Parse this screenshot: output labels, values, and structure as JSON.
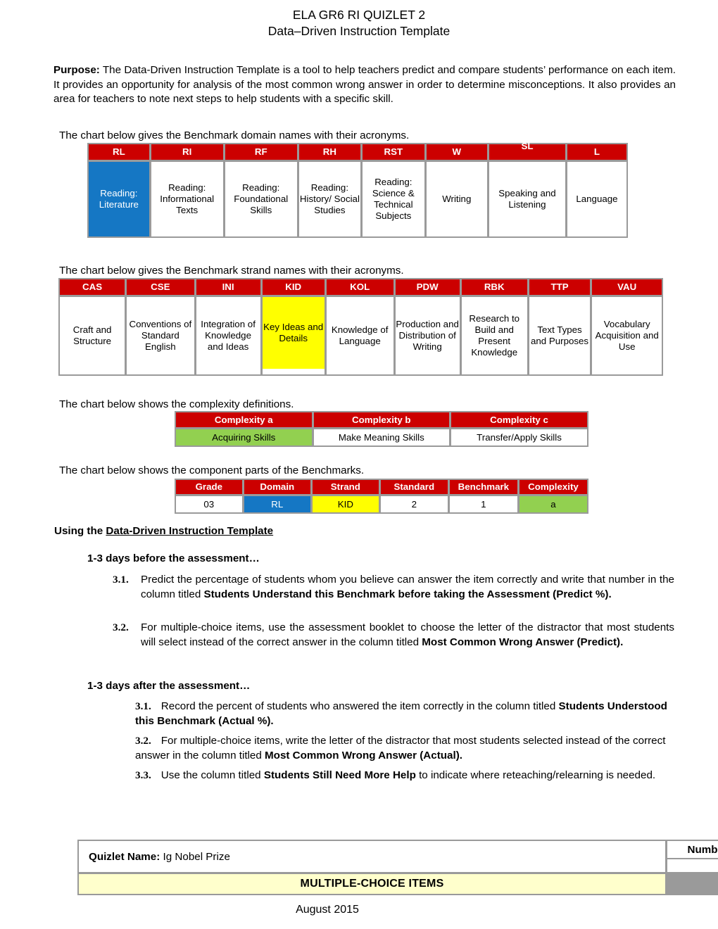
{
  "header": {
    "line1": "ELA GR6 RI QUIZLET 2",
    "line2": "Data–Driven Instruction Template"
  },
  "purpose": {
    "label": "Purpose:",
    "text": " The Data-Driven Instruction Template is a tool to help teachers predict and compare students’ performance on each item.  It provides an opportunity for analysis of the most  common wrong answer in order to determine misconceptions. It also provides an area for teachers to note next steps to help students with a specific skill."
  },
  "captions": {
    "domain": "The chart below gives the Benchmark domain names with their acronyms.",
    "strand": "The chart below gives the Benchmark strand names with their acronyms.",
    "complexity": "The chart below shows the complexity definitions.",
    "parts": "The chart below shows the component parts of the Benchmarks."
  },
  "domain_table": {
    "headers": [
      "RL",
      "RI",
      "RF",
      "RH",
      "RST",
      "W",
      "SL",
      "L"
    ],
    "values": [
      "Reading: Literature",
      "Reading: Informational Texts",
      "Reading: Foundational Skills",
      "Reading: History/ Social Studies",
      "Reading: Science & Technical Subjects",
      "Writing",
      "Speaking and Listening",
      "Language"
    ],
    "highlight_index": 0,
    "highlight_color": "#1577C4"
  },
  "strand_table": {
    "headers": [
      "CAS",
      "CSE",
      "INI",
      "KID",
      "KOL",
      "PDW",
      "RBK",
      "TTP",
      "VAU"
    ],
    "values": [
      "Craft and Structure",
      "Conventions of Standard English",
      "Integration of Knowledge and Ideas",
      "Key Ideas and Details",
      "Knowledge of Language",
      "Production and Distribution of  Writing",
      "Research to Build and Present Knowledge",
      "Text Types and Purposes",
      "Vocabulary Acquisition and Use"
    ],
    "highlight_index": 3,
    "highlight_color": "#FFFF00"
  },
  "complexity_table": {
    "headers": [
      "Complexity a",
      "Complexity b",
      "Complexity c"
    ],
    "values": [
      "Acquiring Skills",
      "Make Meaning Skills",
      "Transfer/Apply Skills"
    ],
    "highlight_index": 0,
    "highlight_color": "#92D050"
  },
  "parts_table": {
    "headers": [
      "Grade",
      "Domain",
      "Strand",
      "Standard",
      "Benchmark",
      "Complexity"
    ],
    "values": [
      "03",
      "RL",
      "KID",
      "2",
      "1",
      "a"
    ]
  },
  "instructions": {
    "using_prefix": "Using the ",
    "using_underlined": "Data-Driven Instruction Template",
    "before_head": "1-3 days before the assessment…",
    "after_head": "1-3 days after the assessment…",
    "before_steps": [
      {
        "num": "3.1.",
        "pre": "Predict the percentage of students whom you believe can answer the item correctly and write that number in the column titled ",
        "bold": "Students Understand this Benchmark before taking the Assessment (Predict %).",
        "post": ""
      },
      {
        "num": "3.2.",
        "pre": "For multiple-choice items, use the assessment booklet to choose the letter of the distractor that most students will select instead of the correct answer in the column titled ",
        "bold": "Most Common Wrong Answer (Predict).",
        "post": ""
      }
    ],
    "after_steps": [
      {
        "num": "3.1.",
        "pre": "Record the percent of students who answered the item correctly in the column titled ",
        "bold": "Students Understood this Benchmark (Actual %).",
        "post": ""
      },
      {
        "num": "3.2.",
        "pre": "For multiple-choice items, write the letter of the distractor that most students selected instead of the correct answer in the column titled ",
        "bold": "Most Common Wrong Answer (Actual).",
        "post": ""
      },
      {
        "num": "3.3.",
        "pre": "Use the column titled ",
        "bold": "Students Still Need More Help",
        "post": " to indicate where reteaching/relearning is needed."
      }
    ]
  },
  "quizlet": {
    "name_label": "Quizlet Name:",
    "name_value": "Ig Nobel Prize",
    "number_header": "Numb",
    "number_value": "",
    "section_title": "MULTIPLE-CHOICE ITEMS"
  },
  "footer": {
    "date": "August 2015"
  },
  "colors": {
    "header_red": "#CC0000",
    "domain_blue": "#1577C4",
    "strand_yellow": "#FFFF00",
    "complexity_green": "#92D050",
    "section_cream": "#FFFFCC",
    "border_gray": "#9A9A9A"
  }
}
